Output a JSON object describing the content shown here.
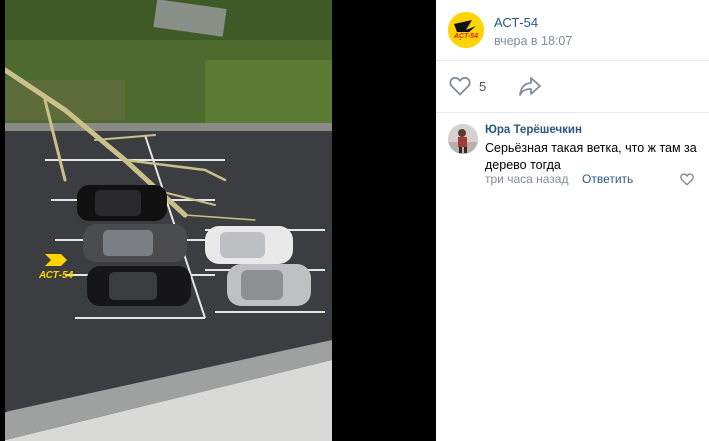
{
  "post": {
    "author": "АСТ-54",
    "date": "вчера в 18:07",
    "avatar_icon": "ast54-logo",
    "likes": "5",
    "photo_watermark": "АСТ-54"
  },
  "comment": {
    "author": "Юра Терёшечкин",
    "text": "Серьёзная такая ветка, что ж там за дерево тогда",
    "time": "три часа назад",
    "reply_label": "Ответить"
  },
  "colors": {
    "link": "#2a5885",
    "muted": "#818c99",
    "brand_yellow": "#ffd400"
  }
}
